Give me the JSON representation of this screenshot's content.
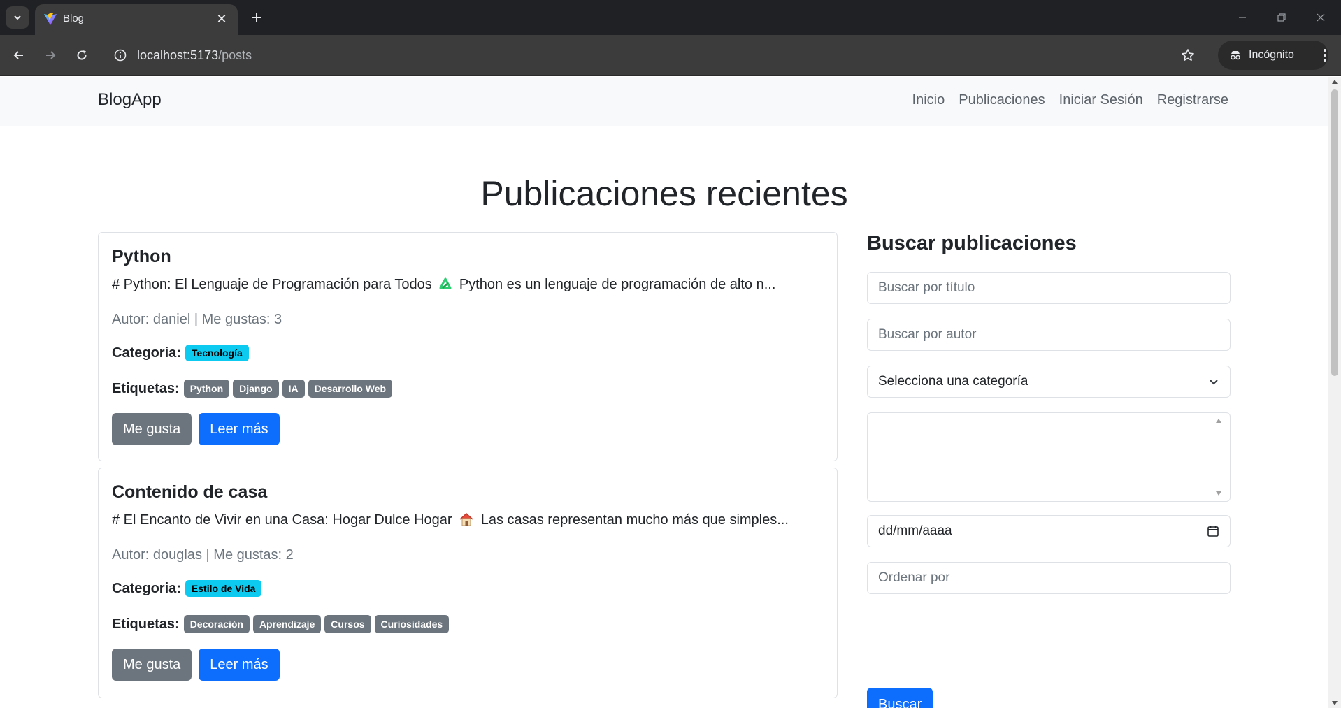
{
  "browser": {
    "tab_title": "Blog",
    "url_host": "localhost:5173",
    "url_path": "/posts",
    "incognito_label": "Incógnito"
  },
  "navbar": {
    "brand": "BlogApp",
    "links": [
      "Inicio",
      "Publicaciones",
      "Iniciar Sesión",
      "Registrarse"
    ]
  },
  "page": {
    "title": "Publicaciones recientes"
  },
  "posts": [
    {
      "title": "Python",
      "excerpt_before_icon": "# Python: El Lenguaje de Programación para Todos",
      "excerpt_icon": "python-emoji-icon",
      "excerpt_after_icon": "Python es un lenguaje de programación de alto n...",
      "meta": "Autor: daniel | Me gustas: 3",
      "category_label": "Categoria:",
      "category": "Tecnología",
      "tags_label": "Etiquetas:",
      "tags": [
        "Python",
        "Django",
        "IA",
        "Desarrollo Web"
      ],
      "like_label": "Me gusta",
      "read_label": "Leer más"
    },
    {
      "title": "Contenido de casa",
      "excerpt_before_icon": "# El Encanto de Vivir en una Casa: Hogar Dulce Hogar",
      "excerpt_icon": "house-emoji-icon",
      "excerpt_after_icon": "Las casas representan mucho más que simples...",
      "meta": "Autor: douglas | Me gustas: 2",
      "category_label": "Categoria:",
      "category": "Estilo de Vida",
      "tags_label": "Etiquetas:",
      "tags": [
        "Decoración",
        "Aprendizaje",
        "Cursos",
        "Curiosidades"
      ],
      "like_label": "Me gusta",
      "read_label": "Leer más"
    }
  ],
  "search": {
    "title": "Buscar publicaciones",
    "title_placeholder": "Buscar por título",
    "author_placeholder": "Buscar por autor",
    "category_select": "Selecciona una categoría",
    "date_placeholder": "dd/mm/aaaa",
    "order_placeholder": "Ordenar por",
    "submit_label": "Buscar"
  },
  "colors": {
    "primary": "#0d6efd",
    "secondary": "#6c757d",
    "info": "#0dcaf0",
    "navbar_bg": "#f8f9fa"
  }
}
